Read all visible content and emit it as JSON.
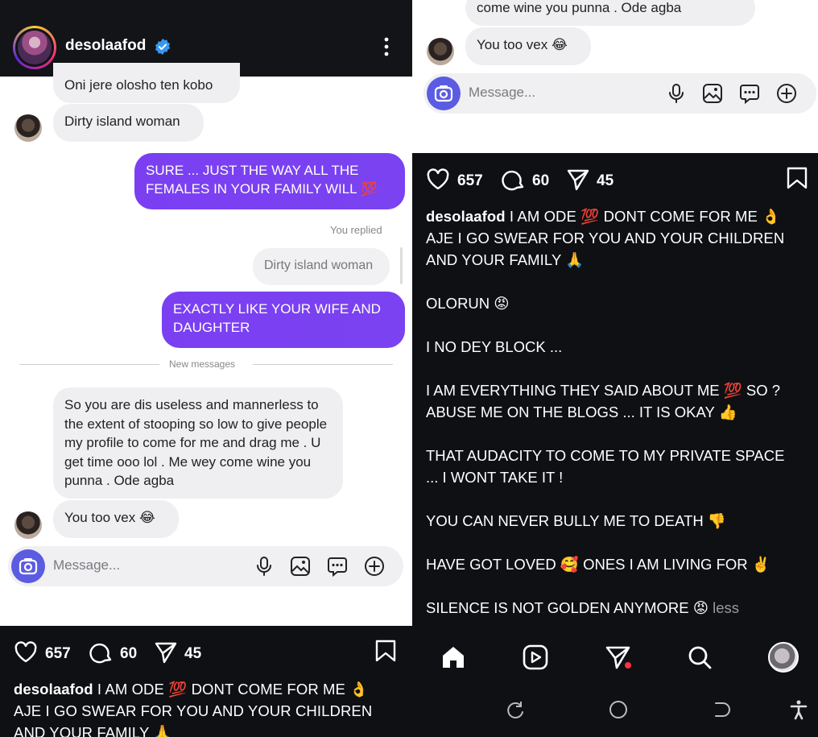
{
  "header": {
    "status": "...",
    "username": "desolaafod"
  },
  "chat": {
    "top_cut": "Oni jere olosho ten kobo",
    "msg1": "Dirty island woman",
    "reply1": "SURE ... JUST THE WAY ALL THE FEMALES IN YOUR FAMILY WILL 💯",
    "you_replied": "You replied",
    "quoted": "Dirty island woman",
    "reply2": "EXACTLY LIKE YOUR WIFE AND DAUGHTER",
    "new_messages": "New messages",
    "msg2": "So you are dis useless and mannerless to the extent of stooping so low to give people my profile to come for me and drag me . U get time ooo lol . Me wey come wine you punna . Ode agba",
    "msg3": "You too vex 😂",
    "right_cut": "come wine you punna . Ode agba"
  },
  "composer": {
    "placeholder": "Message..."
  },
  "post": {
    "likes": "657",
    "comments": "60",
    "shares": "45",
    "username": "desolaafod",
    "caption_first": "I AM ODE 💯 DONT COME FOR ME 👌\nAJE I GO SWEAR FOR YOU AND YOUR CHILDREN\nAND YOUR FAMILY 🙏",
    "left_caption": "I AM ODE 💯 DONT COME FOR ME 👌\nAJE I GO SWEAR FOR YOU AND YOUR CHILDREN\nAND YOUR FAMILY 🙏",
    "paragraphs": [
      "OLORUN 😡",
      "I NO DEY BLOCK ...",
      "I AM EVERYTHING THEY SAID ABOUT ME 💯 SO ?\nABUSE ME ON THE BLOGS ... IT IS OKAY 👍",
      "THAT AUDACITY TO COME TO MY PRIVATE SPACE\n... I WONT TAKE IT !",
      "YOU CAN NEVER BULLY ME TO DEATH 👎",
      "HAVE GOT LOVED 🥰 ONES I AM LIVING FOR ✌️",
      "SILENCE IS NOT GOLDEN ANYMORE 😡"
    ],
    "less": "less"
  },
  "colors": {
    "accent": "#7b3ff2",
    "dark": "#0e1013",
    "bubble": "#efeff1",
    "verified": "#3797f0",
    "notif_dot": "#ff3040"
  }
}
